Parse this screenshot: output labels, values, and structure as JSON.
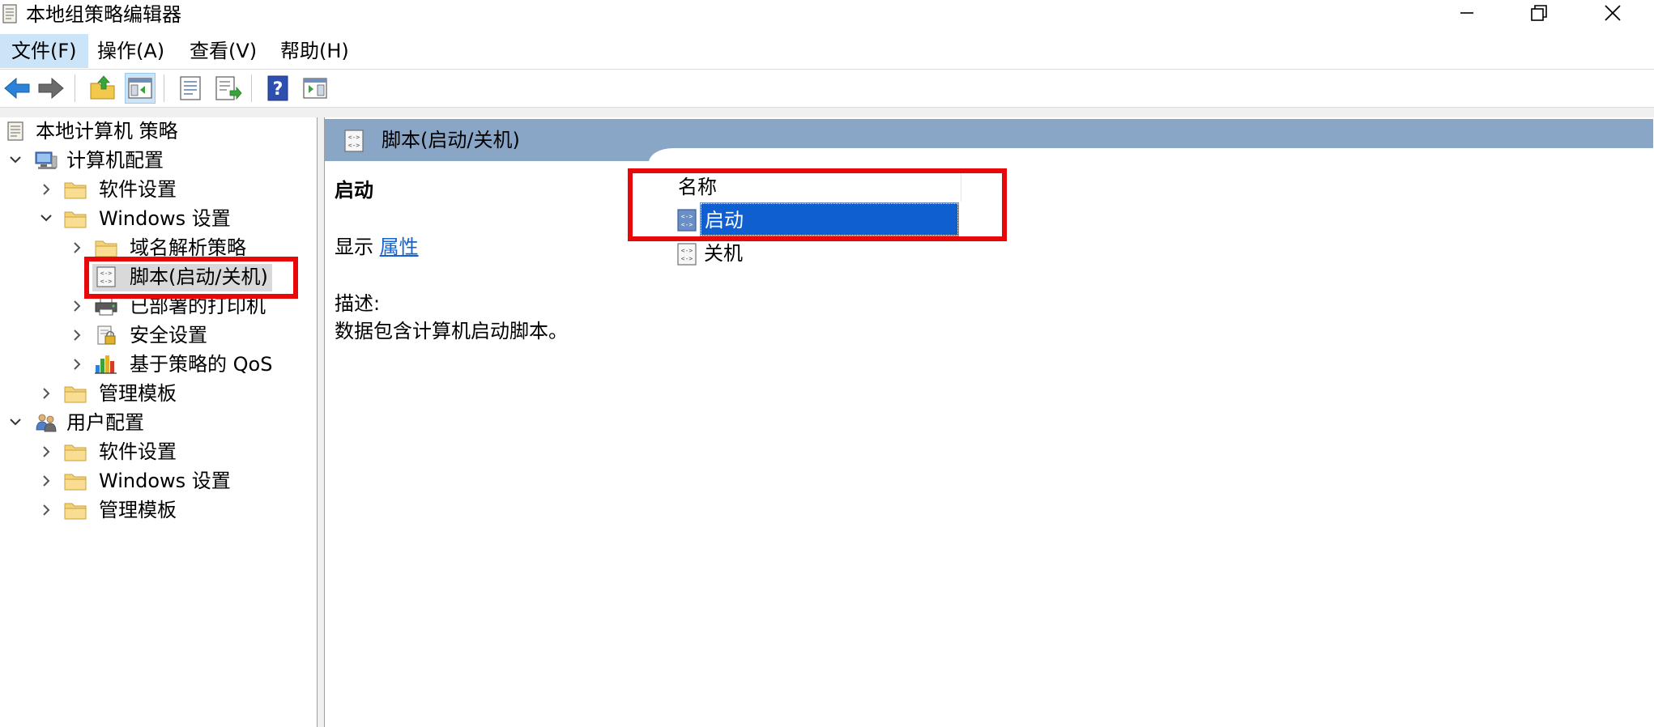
{
  "window": {
    "title": "本地组策略编辑器"
  },
  "menu": {
    "items": [
      {
        "label": "文件(F)"
      },
      {
        "label": "操作(A)"
      },
      {
        "label": "查看(V)"
      },
      {
        "label": "帮助(H)"
      }
    ]
  },
  "tree": {
    "root": "本地计算机 策略",
    "computer_config": "计算机配置",
    "software_settings": "软件设置",
    "windows_settings": "Windows 设置",
    "dns_policy": "域名解析策略",
    "scripts": "脚本(启动/关机)",
    "deployed_printers": "已部署的打印机",
    "security_settings": "安全设置",
    "qos": "基于策略的 QoS",
    "admin_templates": "管理模板",
    "user_config": "用户配置",
    "user_software_settings": "软件设置",
    "user_windows_settings": "Windows 设置",
    "user_admin_templates": "管理模板"
  },
  "right_pane": {
    "header_title": "脚本(启动/关机)",
    "extended": {
      "title": "启动",
      "show_label": "显示",
      "properties_link": "属性",
      "description_label": "描述:",
      "description_text": "数据包含计算机启动脚本。"
    },
    "list": {
      "column_name": "名称",
      "items": [
        {
          "label": "启动",
          "selected": true
        },
        {
          "label": "关机",
          "selected": false
        }
      ]
    }
  },
  "colors": {
    "header_bg": "#8aa6c7",
    "selection": "#0f5fd0",
    "annotation_red": "#e8080a",
    "link": "#1a62c8"
  }
}
